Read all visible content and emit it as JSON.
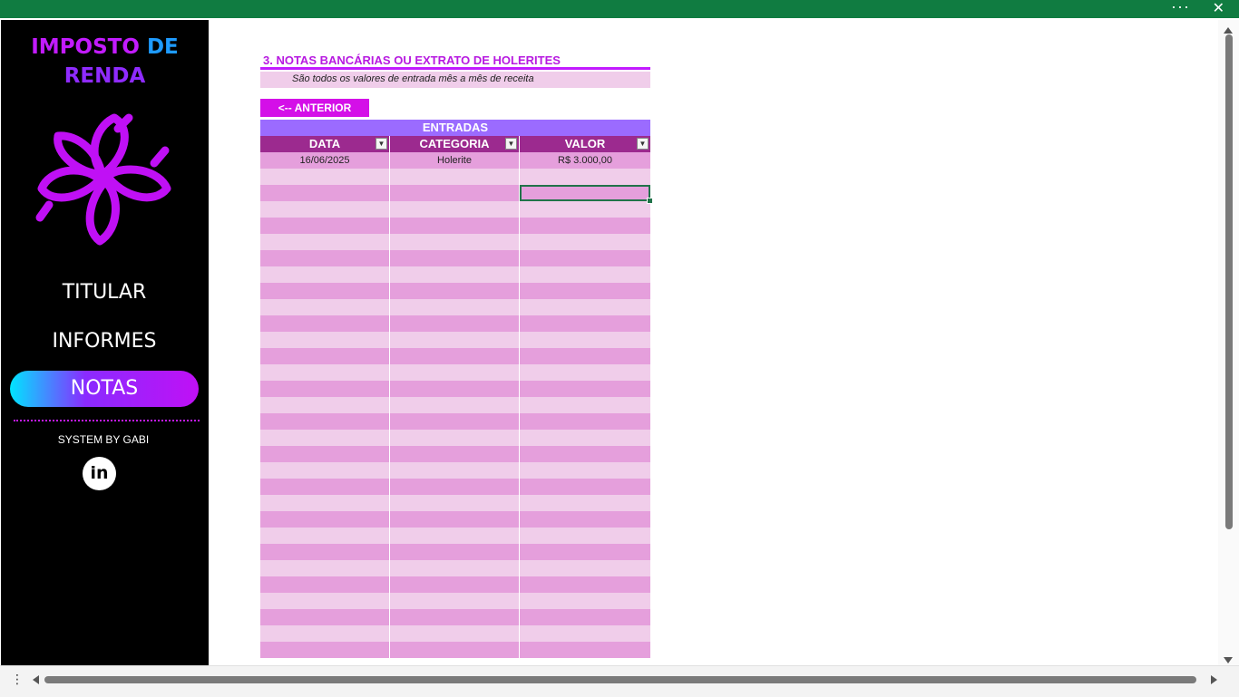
{
  "window": {
    "more_label": "···",
    "close_label": "✕"
  },
  "sidebar": {
    "brand_line1_a": "IMPOSTO",
    "brand_line1_b": "DE",
    "brand_line2": "RENDA",
    "nav": {
      "titular": "TITULAR",
      "informes": "INFORMES",
      "notas": "NOTAS"
    },
    "credit": "SYSTEM BY GABI",
    "linkedin_label": "in"
  },
  "section": {
    "title": "3. NOTAS BANCÁRIAS OU EXTRATO DE HOLERITES",
    "subtitle": "São todos os valores de entrada mês a mês de receita",
    "prev_button": "<-- ANTERIOR"
  },
  "table": {
    "title": "ENTRADAS",
    "columns": [
      "DATA",
      "CATEGORIA",
      "VALOR"
    ],
    "rows": [
      [
        "16/06/2025",
        "Holerite",
        "R$ 3.000,00"
      ]
    ]
  },
  "colors": {
    "ribbon": "#107c41",
    "accent": "#c21bff",
    "header": "#9c2a8f",
    "title_bar": "#9b6bff",
    "row_dark": "#e59fdc",
    "row_light": "#f0cdea",
    "selection": "#21734a"
  },
  "icons": {
    "more": "ellipsis-icon",
    "close": "close-icon",
    "logo": "flower-logo",
    "linkedin": "linkedin-icon",
    "filter": "dropdown-filter-icon"
  }
}
